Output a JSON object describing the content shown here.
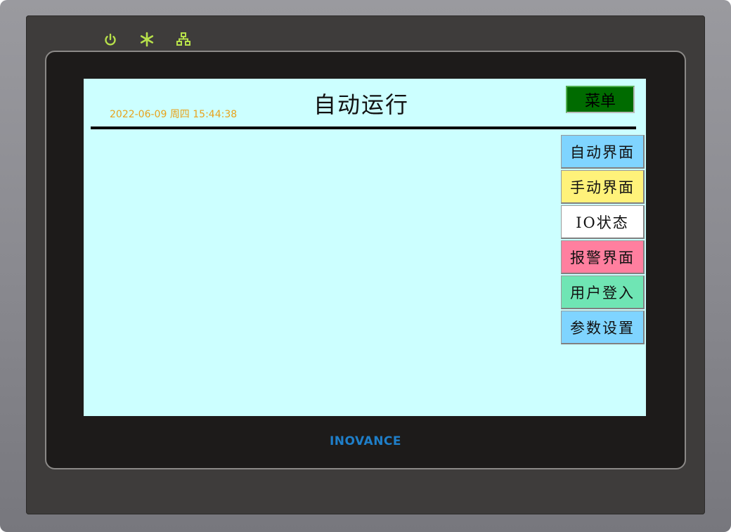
{
  "device": {
    "brand": "INOVANCE",
    "leds": [
      {
        "icon": "power-icon",
        "color": "#b7e04a"
      },
      {
        "icon": "asterisk-icon",
        "color": "#b7e04a"
      },
      {
        "icon": "network-icon",
        "color": "#b7e04a"
      }
    ]
  },
  "screen": {
    "background": "#ccffff",
    "datetime": "2022-06-09 周四 15:44:38",
    "title": "自动运行",
    "menu_button": {
      "label": "菜单",
      "color": "#006b00"
    }
  },
  "nav": [
    {
      "key": "auto",
      "label": "自动界面",
      "color": "#7fd4ff"
    },
    {
      "key": "manual",
      "label": "手动界面",
      "color": "#fff27a"
    },
    {
      "key": "io",
      "label": "IO状态",
      "color": "#ffffff"
    },
    {
      "key": "alarm",
      "label": "报警界面",
      "color": "#ff7f9f"
    },
    {
      "key": "login",
      "label": "用户登入",
      "color": "#6fe5b4"
    },
    {
      "key": "params",
      "label": "参数设置",
      "color": "#7fd4ff"
    }
  ]
}
